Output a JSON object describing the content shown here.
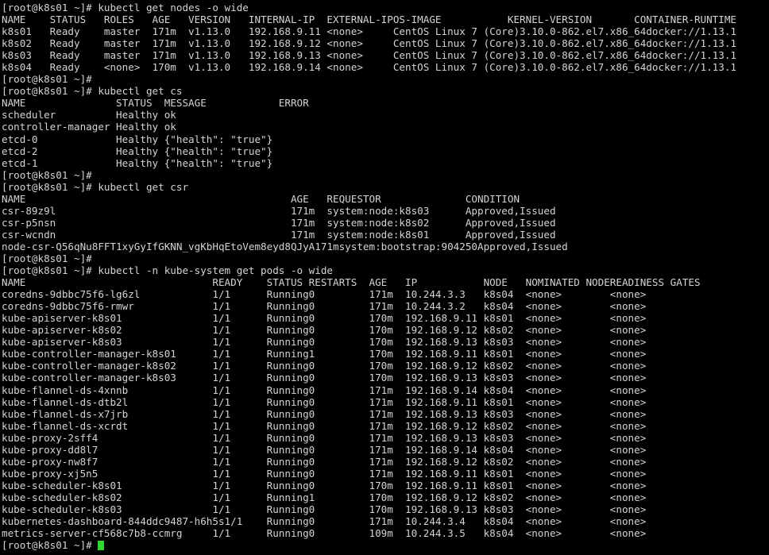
{
  "terminal": {
    "prompt": "[root@k8s01 ~]# ",
    "colors": {
      "background": "#000000",
      "foreground": "#d4d4d4",
      "cursor": "#2fd82f"
    },
    "columns": {
      "char_width": 8,
      "line_height": 15
    }
  },
  "commands": {
    "get_nodes": "kubectl get nodes -o wide",
    "get_cs": "kubectl get cs",
    "get_csr": "kubectl get csr",
    "get_pods": "kubectl -n kube-system get pods -o wide"
  },
  "nodes_table": {
    "headers": [
      "NAME",
      "STATUS",
      "ROLES",
      "AGE",
      "VERSION",
      "INTERNAL-IP",
      "EXTERNAL-IP",
      "OS-IMAGE",
      "KERNEL-VERSION",
      "CONTAINER-RUNTIME"
    ],
    "col_starts": [
      0,
      8,
      17,
      25,
      31,
      41,
      54,
      65,
      84,
      105
    ],
    "rows": [
      [
        "k8s01",
        "Ready",
        "master",
        "171m",
        "v1.13.0",
        "192.168.9.11",
        "<none>",
        "CentOS Linux 7 (Core)",
        "3.10.0-862.el7.x86_64",
        "docker://1.13.1"
      ],
      [
        "k8s02",
        "Ready",
        "master",
        "171m",
        "v1.13.0",
        "192.168.9.12",
        "<none>",
        "CentOS Linux 7 (Core)",
        "3.10.0-862.el7.x86_64",
        "docker://1.13.1"
      ],
      [
        "k8s03",
        "Ready",
        "master",
        "171m",
        "v1.13.0",
        "192.168.9.13",
        "<none>",
        "CentOS Linux 7 (Core)",
        "3.10.0-862.el7.x86_64",
        "docker://1.13.1"
      ],
      [
        "k8s04",
        "Ready",
        "<none>",
        "170m",
        "v1.13.0",
        "192.168.9.14",
        "<none>",
        "CentOS Linux 7 (Core)",
        "3.10.0-862.el7.x86_64",
        "docker://1.13.1"
      ]
    ]
  },
  "cs_table": {
    "headers": [
      "NAME",
      "STATUS",
      "MESSAGE",
      "ERROR"
    ],
    "col_starts": [
      0,
      19,
      27,
      46
    ],
    "rows": [
      [
        "scheduler",
        "Healthy",
        "ok",
        ""
      ],
      [
        "controller-manager",
        "Healthy",
        "ok",
        ""
      ],
      [
        "etcd-0",
        "Healthy",
        "{\"health\": \"true\"}",
        ""
      ],
      [
        "etcd-2",
        "Healthy",
        "{\"health\": \"true\"}",
        ""
      ],
      [
        "etcd-1",
        "Healthy",
        "{\"health\": \"true\"}",
        ""
      ]
    ]
  },
  "csr_table": {
    "headers": [
      "NAME",
      "AGE",
      "REQUESTOR",
      "CONDITION"
    ],
    "col_starts": [
      0,
      48,
      54,
      77
    ],
    "rows": [
      [
        "csr-89z9l",
        "171m",
        "system:node:k8s03",
        "Approved,Issued"
      ],
      [
        "csr-p5nsn",
        "171m",
        "system:node:k8s02",
        "Approved,Issued"
      ],
      [
        "csr-wcndn",
        "171m",
        "system:node:k8s01",
        "Approved,Issued"
      ],
      [
        "node-csr-Q56qNu8FFT1xyGyIfGKNN_vgKbHqEtoVem8eyd8QJyA",
        "171m",
        "system:bootstrap:904250",
        "Approved,Issued"
      ]
    ]
  },
  "pods_table": {
    "headers": [
      "NAME",
      "READY",
      "STATUS",
      "RESTARTS",
      "AGE",
      "IP",
      "NODE",
      "NOMINATED NODE",
      "READINESS GATES"
    ],
    "col_starts": [
      0,
      35,
      44,
      51,
      61,
      67,
      80,
      87,
      101
    ],
    "rows": [
      [
        "coredns-9dbbc75f6-lg6zl",
        "1/1",
        "Running",
        "0",
        "171m",
        "10.244.3.3",
        "k8s04",
        "<none>",
        "<none>"
      ],
      [
        "coredns-9dbbc75f6-rmwr",
        "1/1",
        "Running",
        "0",
        "171m",
        "10.244.3.2",
        "k8s04",
        "<none>",
        "<none>"
      ],
      [
        "kube-apiserver-k8s01",
        "1/1",
        "Running",
        "0",
        "170m",
        "192.168.9.11",
        "k8s01",
        "<none>",
        "<none>"
      ],
      [
        "kube-apiserver-k8s02",
        "1/1",
        "Running",
        "0",
        "170m",
        "192.168.9.12",
        "k8s02",
        "<none>",
        "<none>"
      ],
      [
        "kube-apiserver-k8s03",
        "1/1",
        "Running",
        "0",
        "170m",
        "192.168.9.13",
        "k8s03",
        "<none>",
        "<none>"
      ],
      [
        "kube-controller-manager-k8s01",
        "1/1",
        "Running",
        "1",
        "170m",
        "192.168.9.11",
        "k8s01",
        "<none>",
        "<none>"
      ],
      [
        "kube-controller-manager-k8s02",
        "1/1",
        "Running",
        "0",
        "170m",
        "192.168.9.12",
        "k8s02",
        "<none>",
        "<none>"
      ],
      [
        "kube-controller-manager-k8s03",
        "1/1",
        "Running",
        "0",
        "170m",
        "192.168.9.13",
        "k8s03",
        "<none>",
        "<none>"
      ],
      [
        "kube-flannel-ds-4xnnb",
        "1/1",
        "Running",
        "0",
        "171m",
        "192.168.9.14",
        "k8s04",
        "<none>",
        "<none>"
      ],
      [
        "kube-flannel-ds-dtb2l",
        "1/1",
        "Running",
        "0",
        "171m",
        "192.168.9.11",
        "k8s01",
        "<none>",
        "<none>"
      ],
      [
        "kube-flannel-ds-x7jrb",
        "1/1",
        "Running",
        "0",
        "171m",
        "192.168.9.13",
        "k8s03",
        "<none>",
        "<none>"
      ],
      [
        "kube-flannel-ds-xcrdt",
        "1/1",
        "Running",
        "0",
        "171m",
        "192.168.9.12",
        "k8s02",
        "<none>",
        "<none>"
      ],
      [
        "kube-proxy-2sff4",
        "1/1",
        "Running",
        "0",
        "171m",
        "192.168.9.13",
        "k8s03",
        "<none>",
        "<none>"
      ],
      [
        "kube-proxy-dd8l7",
        "1/1",
        "Running",
        "0",
        "171m",
        "192.168.9.14",
        "k8s04",
        "<none>",
        "<none>"
      ],
      [
        "kube-proxy-nw8f7",
        "1/1",
        "Running",
        "0",
        "171m",
        "192.168.9.12",
        "k8s02",
        "<none>",
        "<none>"
      ],
      [
        "kube-proxy-xj5n5",
        "1/1",
        "Running",
        "0",
        "171m",
        "192.168.9.11",
        "k8s01",
        "<none>",
        "<none>"
      ],
      [
        "kube-scheduler-k8s01",
        "1/1",
        "Running",
        "0",
        "170m",
        "192.168.9.11",
        "k8s01",
        "<none>",
        "<none>"
      ],
      [
        "kube-scheduler-k8s02",
        "1/1",
        "Running",
        "1",
        "170m",
        "192.168.9.12",
        "k8s02",
        "<none>",
        "<none>"
      ],
      [
        "kube-scheduler-k8s03",
        "1/1",
        "Running",
        "0",
        "170m",
        "192.168.9.13",
        "k8s03",
        "<none>",
        "<none>"
      ],
      [
        "kubernetes-dashboard-844ddc9487-h6h5s",
        "1/1",
        "Running",
        "0",
        "171m",
        "10.244.3.4",
        "k8s04",
        "<none>",
        "<none>"
      ],
      [
        "metrics-server-cf568c7b8-ccmrg",
        "1/1",
        "Running",
        "0",
        "109m",
        "10.244.3.5",
        "k8s04",
        "<none>",
        "<none>"
      ]
    ]
  }
}
